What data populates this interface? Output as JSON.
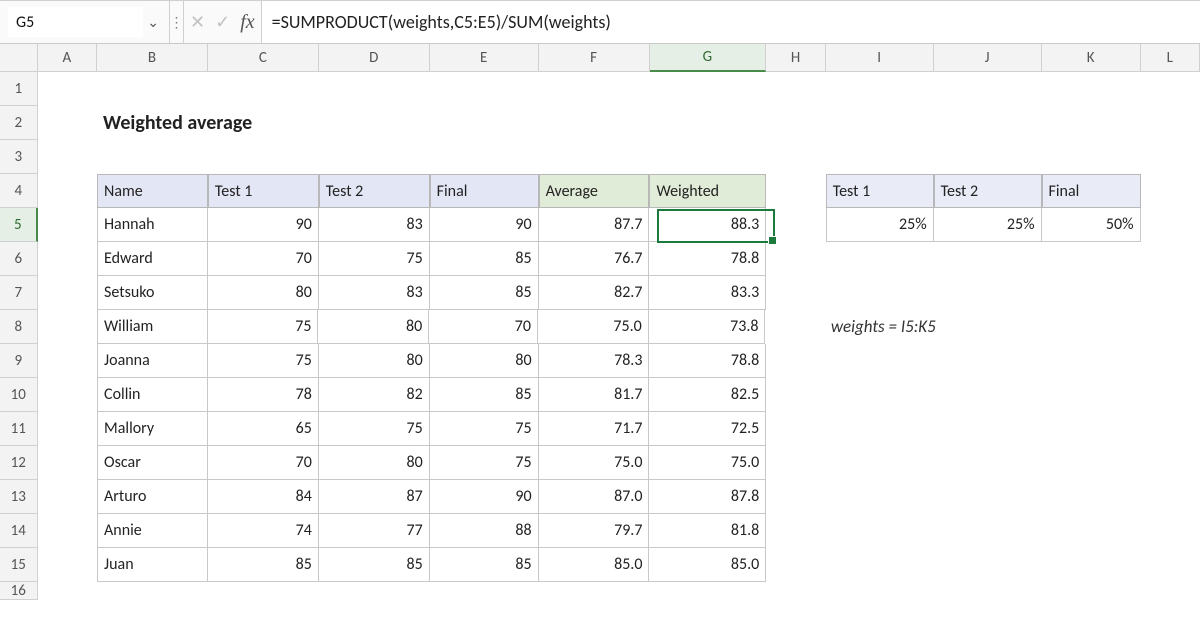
{
  "formula_bar": {
    "name_box": "G5",
    "formula": "=SUMPRODUCT(weights,C5:E5)/SUM(weights)"
  },
  "columns": [
    "A",
    "B",
    "C",
    "D",
    "E",
    "F",
    "G",
    "H",
    "I",
    "J",
    "K",
    "L"
  ],
  "title": "Weighted average",
  "main_table": {
    "headers": [
      "Name",
      "Test 1",
      "Test 2",
      "Final",
      "Average",
      "Weighted"
    ],
    "rows": [
      {
        "name": "Hannah",
        "t1": "90",
        "t2": "83",
        "final": "90",
        "avg": "87.7",
        "wt": "88.3"
      },
      {
        "name": "Edward",
        "t1": "70",
        "t2": "75",
        "final": "85",
        "avg": "76.7",
        "wt": "78.8"
      },
      {
        "name": "Setsuko",
        "t1": "80",
        "t2": "83",
        "final": "85",
        "avg": "82.7",
        "wt": "83.3"
      },
      {
        "name": "William",
        "t1": "75",
        "t2": "80",
        "final": "70",
        "avg": "75.0",
        "wt": "73.8"
      },
      {
        "name": "Joanna",
        "t1": "75",
        "t2": "80",
        "final": "80",
        "avg": "78.3",
        "wt": "78.8"
      },
      {
        "name": "Collin",
        "t1": "78",
        "t2": "82",
        "final": "85",
        "avg": "81.7",
        "wt": "82.5"
      },
      {
        "name": "Mallory",
        "t1": "65",
        "t2": "75",
        "final": "75",
        "avg": "71.7",
        "wt": "72.5"
      },
      {
        "name": "Oscar",
        "t1": "70",
        "t2": "80",
        "final": "75",
        "avg": "75.0",
        "wt": "75.0"
      },
      {
        "name": "Arturo",
        "t1": "84",
        "t2": "87",
        "final": "90",
        "avg": "87.0",
        "wt": "87.8"
      },
      {
        "name": "Annie",
        "t1": "74",
        "t2": "77",
        "final": "88",
        "avg": "79.7",
        "wt": "81.8"
      },
      {
        "name": "Juan",
        "t1": "85",
        "t2": "85",
        "final": "85",
        "avg": "85.0",
        "wt": "85.0"
      }
    ]
  },
  "weights_table": {
    "headers": [
      "Test 1",
      "Test 2",
      "Final"
    ],
    "values": [
      "25%",
      "25%",
      "50%"
    ]
  },
  "note": "weights = I5:K5",
  "active_cell": "G5",
  "chart_data": {
    "type": "table",
    "title": "Weighted average",
    "columns": [
      "Name",
      "Test 1",
      "Test 2",
      "Final",
      "Average",
      "Weighted"
    ],
    "rows": [
      [
        "Hannah",
        90,
        83,
        90,
        87.7,
        88.3
      ],
      [
        "Edward",
        70,
        75,
        85,
        76.7,
        78.8
      ],
      [
        "Setsuko",
        80,
        83,
        85,
        82.7,
        83.3
      ],
      [
        "William",
        75,
        80,
        70,
        75.0,
        73.8
      ],
      [
        "Joanna",
        75,
        80,
        80,
        78.3,
        78.8
      ],
      [
        "Collin",
        78,
        82,
        85,
        81.7,
        82.5
      ],
      [
        "Mallory",
        65,
        75,
        75,
        71.7,
        72.5
      ],
      [
        "Oscar",
        70,
        80,
        75,
        75.0,
        75.0
      ],
      [
        "Arturo",
        84,
        87,
        90,
        87.0,
        87.8
      ],
      [
        "Annie",
        74,
        77,
        88,
        79.7,
        81.8
      ],
      [
        "Juan",
        85,
        85,
        85,
        85.0,
        85.0
      ]
    ],
    "weights": {
      "Test 1": 0.25,
      "Test 2": 0.25,
      "Final": 0.5
    }
  }
}
